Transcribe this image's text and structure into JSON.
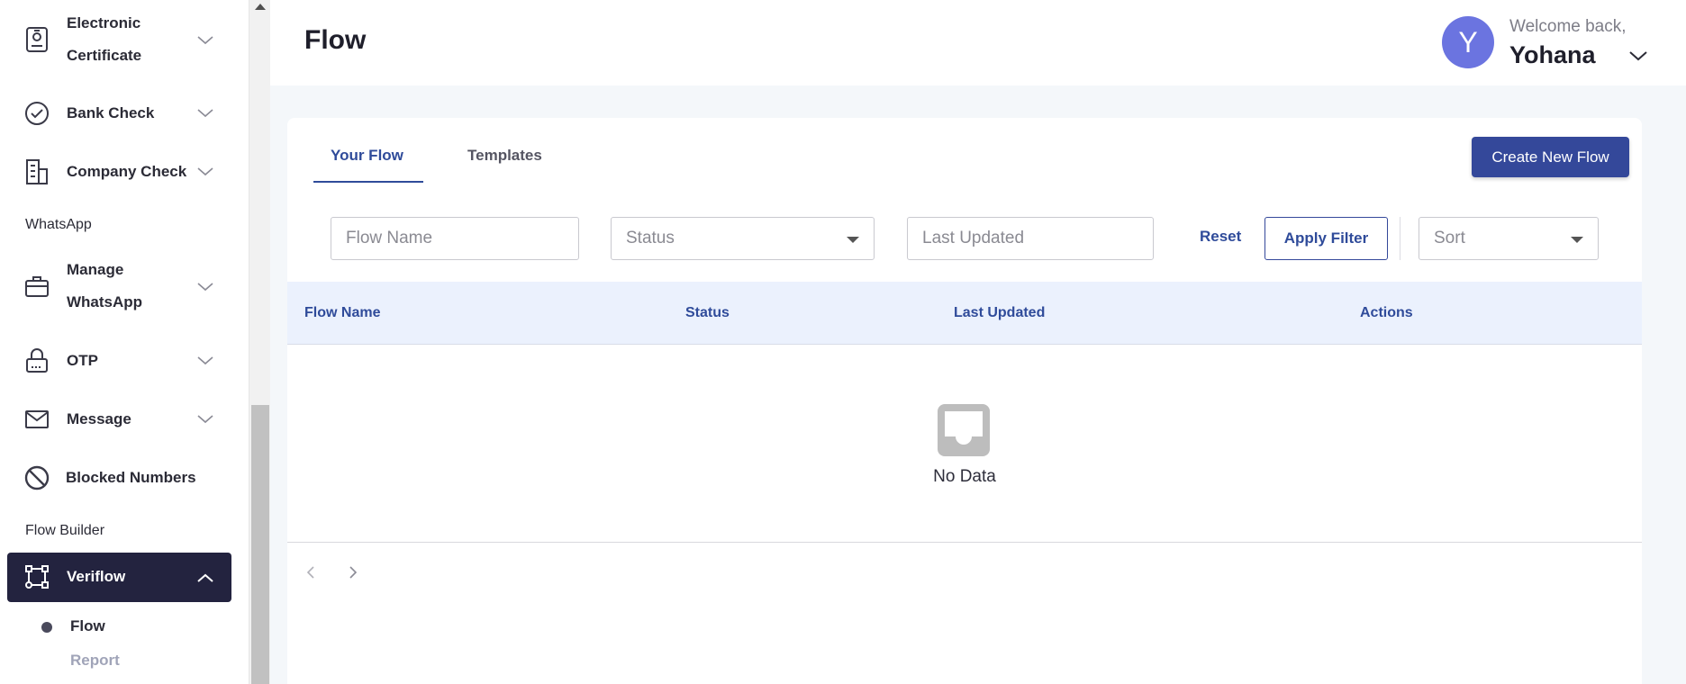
{
  "sidebar": {
    "items": [
      {
        "label_line1": "Electronic",
        "label_line2": "Certificate",
        "icon": "certificate-icon"
      },
      {
        "label": "Bank Check",
        "icon": "check-circle-icon"
      },
      {
        "label": "Company Check",
        "icon": "building-icon"
      },
      {
        "label_line1": "Manage",
        "label_line2": "WhatsApp",
        "icon": "briefcase-icon"
      },
      {
        "label": "OTP",
        "icon": "lock-icon"
      },
      {
        "label": "Message",
        "icon": "envelope-icon"
      },
      {
        "label": "Blocked Numbers",
        "icon": "blocked-icon"
      },
      {
        "label": "Veriflow",
        "icon": "flow-icon"
      }
    ],
    "sections": {
      "whatsapp": "WhatsApp",
      "flow_builder": "Flow Builder"
    },
    "sub_items": [
      {
        "label": "Flow",
        "active": true
      },
      {
        "label": "Report",
        "active": false
      }
    ]
  },
  "header": {
    "title": "Flow",
    "avatar_letter": "Y",
    "welcome": "Welcome back,",
    "username": "Yohana"
  },
  "main": {
    "tabs": [
      {
        "label": "Your Flow",
        "active": true
      },
      {
        "label": "Templates",
        "active": false
      }
    ],
    "create_button": "Create New Flow",
    "filters": {
      "flow_name_placeholder": "Flow Name",
      "status_placeholder": "Status",
      "last_updated_placeholder": "Last Updated",
      "reset": "Reset",
      "apply": "Apply Filter",
      "sort_placeholder": "Sort"
    },
    "table": {
      "columns": [
        "Flow Name",
        "Status",
        "Last Updated",
        "Actions"
      ],
      "rows": [],
      "empty_text": "No Data"
    }
  },
  "colors": {
    "accent": "#34489a",
    "sidebar_active": "#23233f",
    "avatar": "#6b74e0",
    "table_header_bg": "#ebf1fd"
  }
}
